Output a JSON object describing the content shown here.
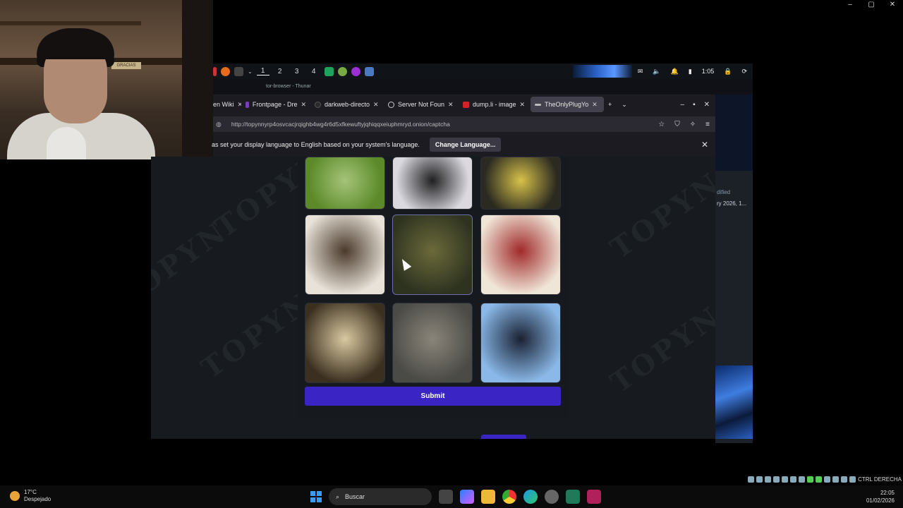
{
  "desktop": {
    "win_controls": [
      "–",
      "▢",
      "✕"
    ]
  },
  "webcam": {
    "sign_text": "GRACIAS"
  },
  "remote_taskbar": {
    "workspaces": [
      "1",
      "2",
      "3",
      "4"
    ],
    "time": "1:05",
    "subtitle": "tor-browser - Thunar"
  },
  "browser": {
    "tabs": [
      {
        "label": "en Wiki",
        "color": "#888888"
      },
      {
        "label": "Frontpage - Dre",
        "color": "#7a3fb8"
      },
      {
        "label": "darkweb-directo",
        "color": "#555555"
      },
      {
        "label": "Server Not Foun",
        "color": "#cccccc"
      },
      {
        "label": "dump.li - image",
        "color": "#d3222a"
      },
      {
        "label": "TheOnlyPlugYo",
        "color": "#bbbbbb"
      }
    ],
    "url": "http://topynnyrp4osvcacjrqighb4wg4r6d5xfkewuftyjqhiqqxeiuphmryd.onion/captcha",
    "notification": {
      "message": "as set your display language to English based on your system's language.",
      "button": "Change Language..."
    }
  },
  "page": {
    "watermark": "TOPYN",
    "submit_label": "Submit",
    "tiles": [
      {
        "name": "bird-in-grass",
        "c1": "#5c8a2a",
        "c2": "#a5c47a"
      },
      {
        "name": "dark-animal",
        "c1": "#d9d9df",
        "c2": "#202022"
      },
      {
        "name": "yellow-flowers",
        "c1": "#2b2a20",
        "c2": "#d7c24a"
      },
      {
        "name": "shelves",
        "c1": "#e8e2d8",
        "c2": "#4a3a2c"
      },
      {
        "name": "squirrel",
        "c1": "#2e3320",
        "c2": "#6b6a3a"
      },
      {
        "name": "wine-bottles",
        "c1": "#f0e6d8",
        "c2": "#a02a2a"
      },
      {
        "name": "raccoon",
        "c1": "#3b3020",
        "c2": "#d9c8a0"
      },
      {
        "name": "frog-gravel",
        "c1": "#4a4a46",
        "c2": "#8a857a"
      },
      {
        "name": "whale",
        "c1": "#8ab8e8",
        "c2": "#1a2233"
      }
    ]
  },
  "right_panel": {
    "label1": "dified",
    "label2": "ry 2026, 1..."
  },
  "windows_taskbar": {
    "temperature": "17°C",
    "condition": "Despejado",
    "search_placeholder": "Buscar",
    "keyboard_label": "CTRL DERECHA",
    "time": "22:05",
    "date": "01/02/2026"
  }
}
